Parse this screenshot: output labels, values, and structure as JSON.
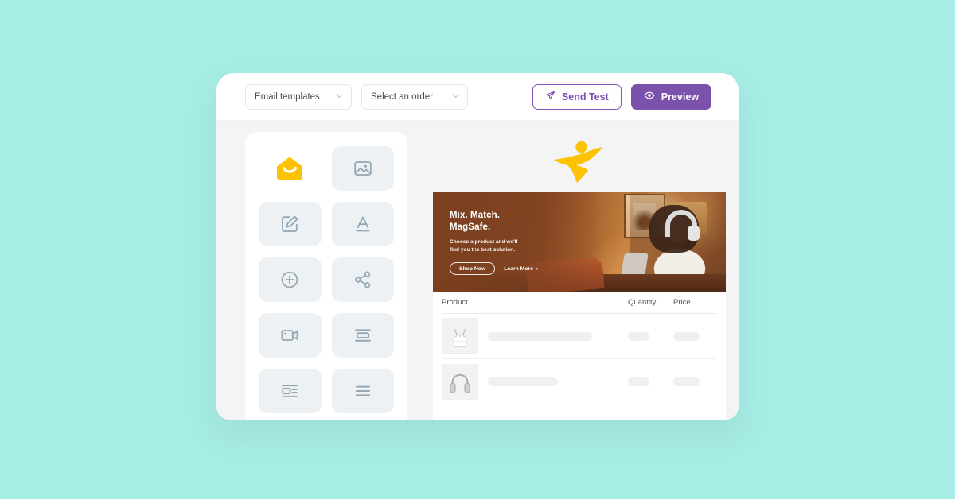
{
  "theme": {
    "page_background": "#a6ede5",
    "accent_purple": "#7a52ab",
    "brand_yellow": "#fdc300",
    "app_body": "#f4f4f4"
  },
  "toolbar": {
    "template_select": {
      "value": "Email templates",
      "icon": "chevron-down-icon"
    },
    "order_select": {
      "value": "Select an order",
      "icon": "chevron-down-icon"
    },
    "send_test_button": {
      "label": "Send Test",
      "icon": "send-plane-icon"
    },
    "preview_button": {
      "label": "Preview",
      "icon": "eye-icon"
    }
  },
  "sidebar": {
    "tiles": [
      {
        "name": "email-block",
        "icon": "envelope-smile-icon",
        "active": true
      },
      {
        "name": "image-block",
        "icon": "image-icon",
        "active": false
      },
      {
        "name": "edit-block",
        "icon": "edit-square-icon",
        "active": false
      },
      {
        "name": "text-style-block",
        "icon": "text-letter-a-icon",
        "active": false
      },
      {
        "name": "add-block",
        "icon": "plus-circle-icon",
        "active": false
      },
      {
        "name": "share-block",
        "icon": "share-nodes-icon",
        "active": false
      },
      {
        "name": "video-block",
        "icon": "video-camera-icon",
        "active": false
      },
      {
        "name": "button-block",
        "icon": "button-bar-icon",
        "active": false
      },
      {
        "name": "image-text-block",
        "icon": "image-text-layout-icon",
        "active": false
      },
      {
        "name": "paragraph-block",
        "icon": "text-lines-icon",
        "active": false
      }
    ]
  },
  "email_preview": {
    "logo": "leaping-person-logo",
    "banner": {
      "title_line1": "Mix. Match.",
      "title_line2": "MagSafe.",
      "subtitle_line1": "Choose a product and we'll",
      "subtitle_line2": "find you the best solution.",
      "primary_cta": "Shop Now",
      "secondary_cta": "Learn More",
      "secondary_cta_chevron": "›"
    },
    "table": {
      "headers": {
        "product": "Product",
        "quantity": "Quantity",
        "price": "Price"
      },
      "rows": [
        {
          "thumbnail": "airpods-pro-case-image",
          "name_placeholder": "",
          "quantity_placeholder": "",
          "price_placeholder": ""
        },
        {
          "thumbnail": "over-ear-headphones-image",
          "name_placeholder": "",
          "quantity_placeholder": "",
          "price_placeholder": ""
        }
      ]
    }
  }
}
